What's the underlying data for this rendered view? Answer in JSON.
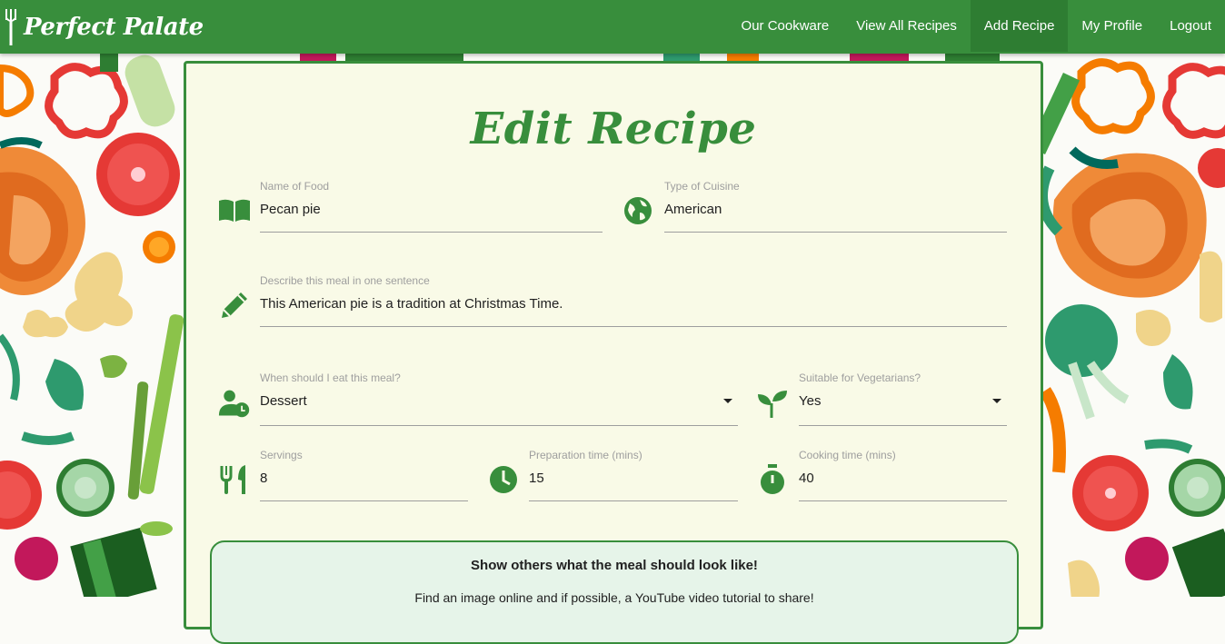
{
  "nav": {
    "brand": "Perfect Palate",
    "links": [
      {
        "label": "Our Cookware"
      },
      {
        "label": "View All Recipes"
      },
      {
        "label": "Add Recipe"
      },
      {
        "label": "My Profile"
      },
      {
        "label": "Logout"
      }
    ],
    "active_index": 2,
    "color": "#388e3c",
    "active_color": "#2e7d32"
  },
  "form": {
    "title": "Edit Recipe",
    "name": {
      "label": "Name of Food",
      "value": "Pecan pie",
      "icon": "book-icon"
    },
    "cuisine": {
      "label": "Type of Cuisine",
      "value": "American",
      "icon": "globe-icon"
    },
    "description": {
      "label": "Describe this meal in one sentence",
      "value": "This American pie is a tradition at Christmas Time.",
      "icon": "pencil-icon"
    },
    "meal_time": {
      "label": "When should I eat this meal?",
      "value": "Dessert",
      "icon": "person-clock-icon"
    },
    "vegetarian": {
      "label": "Suitable for Vegetarians?",
      "value": "Yes",
      "icon": "sprout-icon"
    },
    "servings": {
      "label": "Servings",
      "value": "8",
      "icon": "fork-knife-icon"
    },
    "prep_time": {
      "label": "Preparation time (mins)",
      "value": "15",
      "icon": "clock-icon"
    },
    "cook_time": {
      "label": "Cooking time (mins)",
      "value": "40",
      "icon": "stopwatch-icon"
    }
  },
  "photo_section": {
    "title": "Show others what the meal should look like!",
    "subtitle": "Find an image online and if possible, a YouTube video tutorial to share!"
  },
  "colors": {
    "accent": "#388e3c",
    "card_bg": "#f9fae7",
    "photo_bg": "#e6f4e9"
  }
}
